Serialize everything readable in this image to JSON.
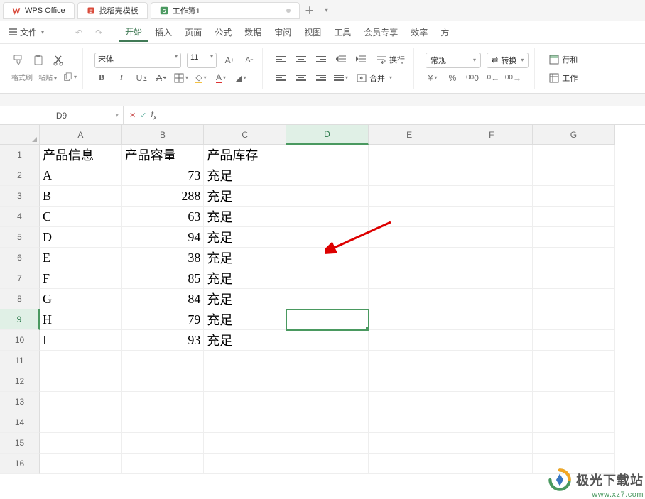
{
  "app": {
    "name": "WPS Office"
  },
  "tabs": [
    {
      "label": "WPS Office"
    },
    {
      "label": "找稻壳模板"
    },
    {
      "label": "工作簿1"
    }
  ],
  "menu": {
    "file": "文件",
    "items": [
      "开始",
      "插入",
      "页面",
      "公式",
      "数据",
      "审阅",
      "视图",
      "工具",
      "会员专享",
      "效率",
      "方"
    ],
    "active": "开始"
  },
  "ribbon": {
    "format_painter": "格式刷",
    "paste": "粘贴",
    "font_name": "宋体",
    "font_size": "11",
    "wrap": "换行",
    "merge": "合并",
    "number_format": "常规",
    "convert": "转换",
    "rowcol": "行和",
    "worksheet": "工作"
  },
  "namebox": "D9",
  "columns": [
    "A",
    "B",
    "C",
    "D",
    "E",
    "F",
    "G"
  ],
  "row_count": 16,
  "headers": {
    "c0": "产品信息",
    "c1": "产品容量",
    "c2": "产品库存"
  },
  "rows": [
    {
      "a": "A",
      "b": "73",
      "c": "充足"
    },
    {
      "a": "B",
      "b": "288",
      "c": "充足"
    },
    {
      "a": "C",
      "b": "63",
      "c": "充足"
    },
    {
      "a": "D",
      "b": "94",
      "c": "充足"
    },
    {
      "a": "E",
      "b": "38",
      "c": "充足"
    },
    {
      "a": "F",
      "b": "85",
      "c": "充足"
    },
    {
      "a": "G",
      "b": "84",
      "c": "充足"
    },
    {
      "a": "H",
      "b": "79",
      "c": "充足"
    },
    {
      "a": "I",
      "b": "93",
      "c": "充足"
    }
  ],
  "selected_cell": {
    "row": 9,
    "col": "D"
  },
  "watermark": {
    "text": "极光下载站",
    "url": "www.xz7.com"
  }
}
